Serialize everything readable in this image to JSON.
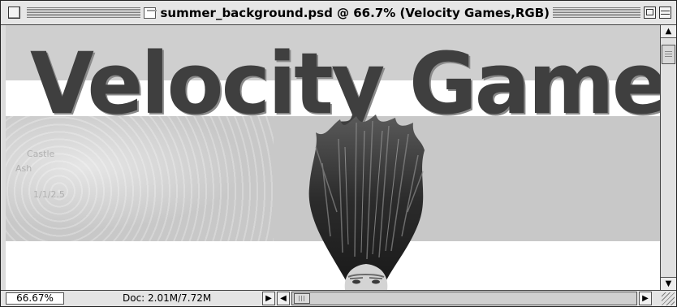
{
  "window": {
    "title": "summer_background.psd @ 66.7% (Velocity Games,RGB)"
  },
  "canvas": {
    "headline": "Velocity Games",
    "map_labels": [
      "Castle",
      "Ash",
      "1/1/2.5"
    ],
    "colors": {
      "headline": "#3f3f3f",
      "band_gray": "#c8c8c8",
      "band_white": "#ffffff"
    }
  },
  "status": {
    "zoom": "66.67%",
    "doc_info": "Doc: 2.01M/7.72M"
  },
  "icons": {
    "close": "close-box-icon",
    "document": "document-icon",
    "zoom": "zoom-box-icon",
    "collapse": "collapse-box-icon",
    "scroll_up": "up-arrow-icon",
    "scroll_down": "down-arrow-icon",
    "status_right": "right-arrow-icon",
    "scroll_left": "left-arrow-icon",
    "scroll_right": "right-arrow-icon",
    "resize": "resize-grip-icon"
  }
}
